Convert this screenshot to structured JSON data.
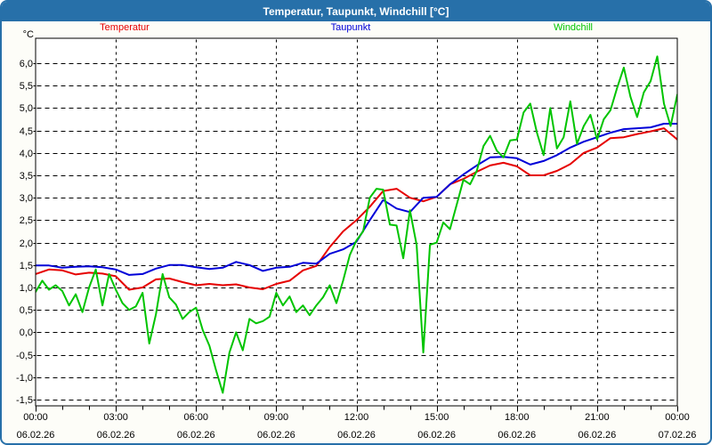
{
  "window": {
    "title": "Temperatur, Taupunkt, Windchill [°C]"
  },
  "chart_data": {
    "type": "line",
    "title": "Temperatur, Taupunkt, Windchill [°C]",
    "xlabel": "",
    "ylabel": "°C",
    "ylim": [
      -1.5,
      6.0
    ],
    "y_tick_step": 0.5,
    "y_tick_decimal_separator": ",",
    "x_range_hours": [
      0,
      24
    ],
    "x_gridline_step_hours": 3,
    "x_minor_tick_step_hours": 1,
    "grid": "dashed",
    "legend_position": "top",
    "x_ticks": [
      {
        "time": "00:00",
        "date": "06.02.26"
      },
      {
        "time": "03:00",
        "date": "06.02.26"
      },
      {
        "time": "06:00",
        "date": "06.02.26"
      },
      {
        "time": "09:00",
        "date": "06.02.26"
      },
      {
        "time": "12:00",
        "date": "06.02.26"
      },
      {
        "time": "15:00",
        "date": "06.02.26"
      },
      {
        "time": "18:00",
        "date": "06.02.26"
      },
      {
        "time": "21:00",
        "date": "06.02.26"
      },
      {
        "time": "00:00",
        "date": "07.02.26"
      }
    ],
    "series": [
      {
        "name": "Temperatur",
        "color": "#e60000",
        "dt_hours": 0.5,
        "values": [
          1.3,
          1.4,
          1.38,
          1.29,
          1.33,
          1.31,
          1.25,
          0.95,
          1.0,
          1.18,
          1.2,
          1.12,
          1.05,
          1.08,
          1.05,
          1.07,
          1.0,
          0.96,
          1.08,
          1.15,
          1.38,
          1.48,
          1.9,
          2.25,
          2.5,
          2.8,
          3.15,
          3.2,
          3.0,
          2.92,
          3.02,
          3.3,
          3.42,
          3.58,
          3.72,
          3.78,
          3.7,
          3.5,
          3.5,
          3.6,
          3.75,
          4.0,
          4.12,
          4.33,
          4.35,
          4.42,
          4.48,
          4.55,
          4.3
        ]
      },
      {
        "name": "Taupunkt",
        "color": "#0000d8",
        "dt_hours": 0.5,
        "values": [
          1.49,
          1.49,
          1.44,
          1.46,
          1.47,
          1.45,
          1.4,
          1.28,
          1.3,
          1.42,
          1.5,
          1.5,
          1.45,
          1.41,
          1.44,
          1.57,
          1.5,
          1.37,
          1.44,
          1.46,
          1.55,
          1.53,
          1.75,
          1.85,
          2.02,
          2.5,
          2.95,
          2.76,
          2.68,
          3.0,
          3.02,
          3.3,
          3.52,
          3.72,
          3.9,
          3.91,
          3.88,
          3.74,
          3.82,
          3.95,
          4.12,
          4.25,
          4.35,
          4.45,
          4.53,
          4.55,
          4.57,
          4.65,
          4.65
        ]
      },
      {
        "name": "Windchill",
        "color": "#00c400",
        "dt_hours": 0.25,
        "values": [
          0.9,
          1.15,
          0.95,
          1.05,
          0.92,
          0.6,
          0.85,
          0.45,
          1.0,
          1.4,
          0.6,
          1.3,
          0.95,
          0.65,
          0.5,
          0.58,
          0.88,
          -0.25,
          0.4,
          1.3,
          0.78,
          0.62,
          0.3,
          0.45,
          0.55,
          0.05,
          -0.3,
          -0.85,
          -1.35,
          -0.45,
          0.0,
          -0.4,
          0.3,
          0.2,
          0.25,
          0.35,
          0.88,
          0.6,
          0.8,
          0.45,
          0.6,
          0.38,
          0.6,
          0.78,
          1.05,
          0.65,
          1.15,
          1.72,
          2.05,
          2.25,
          3.0,
          3.2,
          3.18,
          2.4,
          2.38,
          1.65,
          2.72,
          1.95,
          -0.45,
          1.95,
          2.0,
          2.45,
          2.3,
          2.85,
          3.4,
          3.3,
          3.6,
          4.15,
          4.38,
          4.05,
          3.9,
          4.28,
          4.3,
          4.9,
          5.1,
          4.45,
          3.95,
          5.0,
          4.1,
          4.35,
          5.15,
          4.2,
          4.6,
          4.85,
          4.3,
          4.75,
          4.95,
          5.45,
          5.9,
          5.25,
          4.8,
          5.35,
          5.6,
          6.15,
          5.1,
          4.6,
          5.3
        ]
      }
    ]
  }
}
